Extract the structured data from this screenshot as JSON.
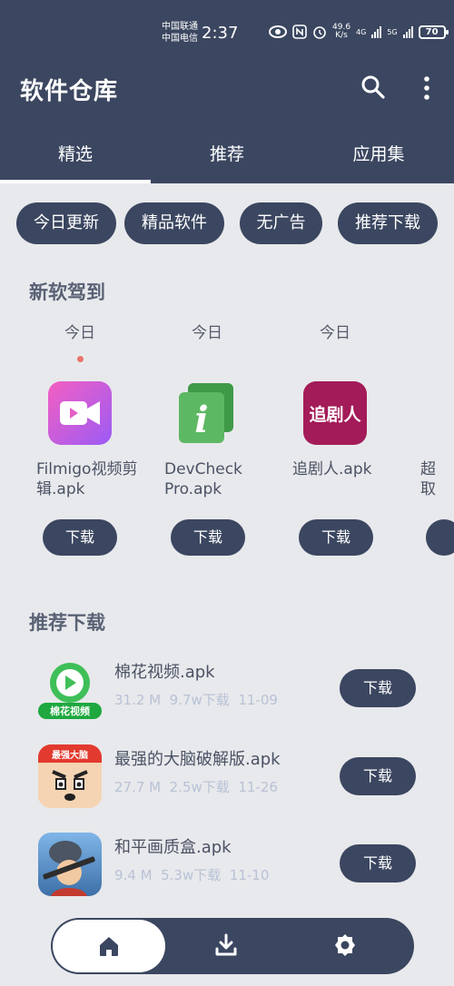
{
  "status_bar": {
    "carrier1": "中国联通",
    "carrier2": "中国电信",
    "time": "2:37",
    "net_speed_value": "49.6",
    "net_speed_unit": "K/s",
    "net_type1": "4G",
    "net_type2": "5G",
    "battery": "70"
  },
  "header": {
    "title": "软件仓库",
    "icons": [
      "search-icon",
      "more-vertical-icon"
    ]
  },
  "tabs": [
    {
      "label": "精选",
      "active": true
    },
    {
      "label": "推荐"
    },
    {
      "label": "应用集"
    }
  ],
  "chips": [
    "今日更新",
    "精品软件",
    "无广告",
    "推荐下载"
  ],
  "new_section": {
    "title": "新软驾到",
    "items": [
      {
        "date": "今日",
        "name": "Filmigo视频剪辑.apk",
        "button": "下载",
        "has_dot": true
      },
      {
        "date": "今日",
        "name": "DevCheck Pro.apk",
        "button": "下载"
      },
      {
        "date": "今日",
        "name": "追剧人.apk",
        "button": "下载",
        "icon_text": "追剧人"
      },
      {
        "name": "超取"
      }
    ]
  },
  "recommend_section": {
    "title": "推荐下载",
    "items": [
      {
        "name": "棉花视频.apk",
        "size": "31.2 M",
        "downloads": "9.7w下载",
        "date": "11-09",
        "button": "下载",
        "icon_text": "棉花视频"
      },
      {
        "name": "最强的大脑破解版.apk",
        "size": "27.7 M",
        "downloads": "2.5w下载",
        "date": "11-26",
        "button": "下载",
        "icon_text": "最强大脑"
      },
      {
        "name": "和平画质盒.apk",
        "size": "9.4 M",
        "downloads": "5.3w下载",
        "date": "11-10",
        "button": "下载"
      }
    ]
  },
  "bottom_nav": [
    "home-icon",
    "download-icon",
    "settings-icon"
  ],
  "colors": {
    "primary": "#3b4660",
    "background": "#e8e9ec",
    "meta_text": "#b8c2d6",
    "dot": "#e8756a"
  }
}
